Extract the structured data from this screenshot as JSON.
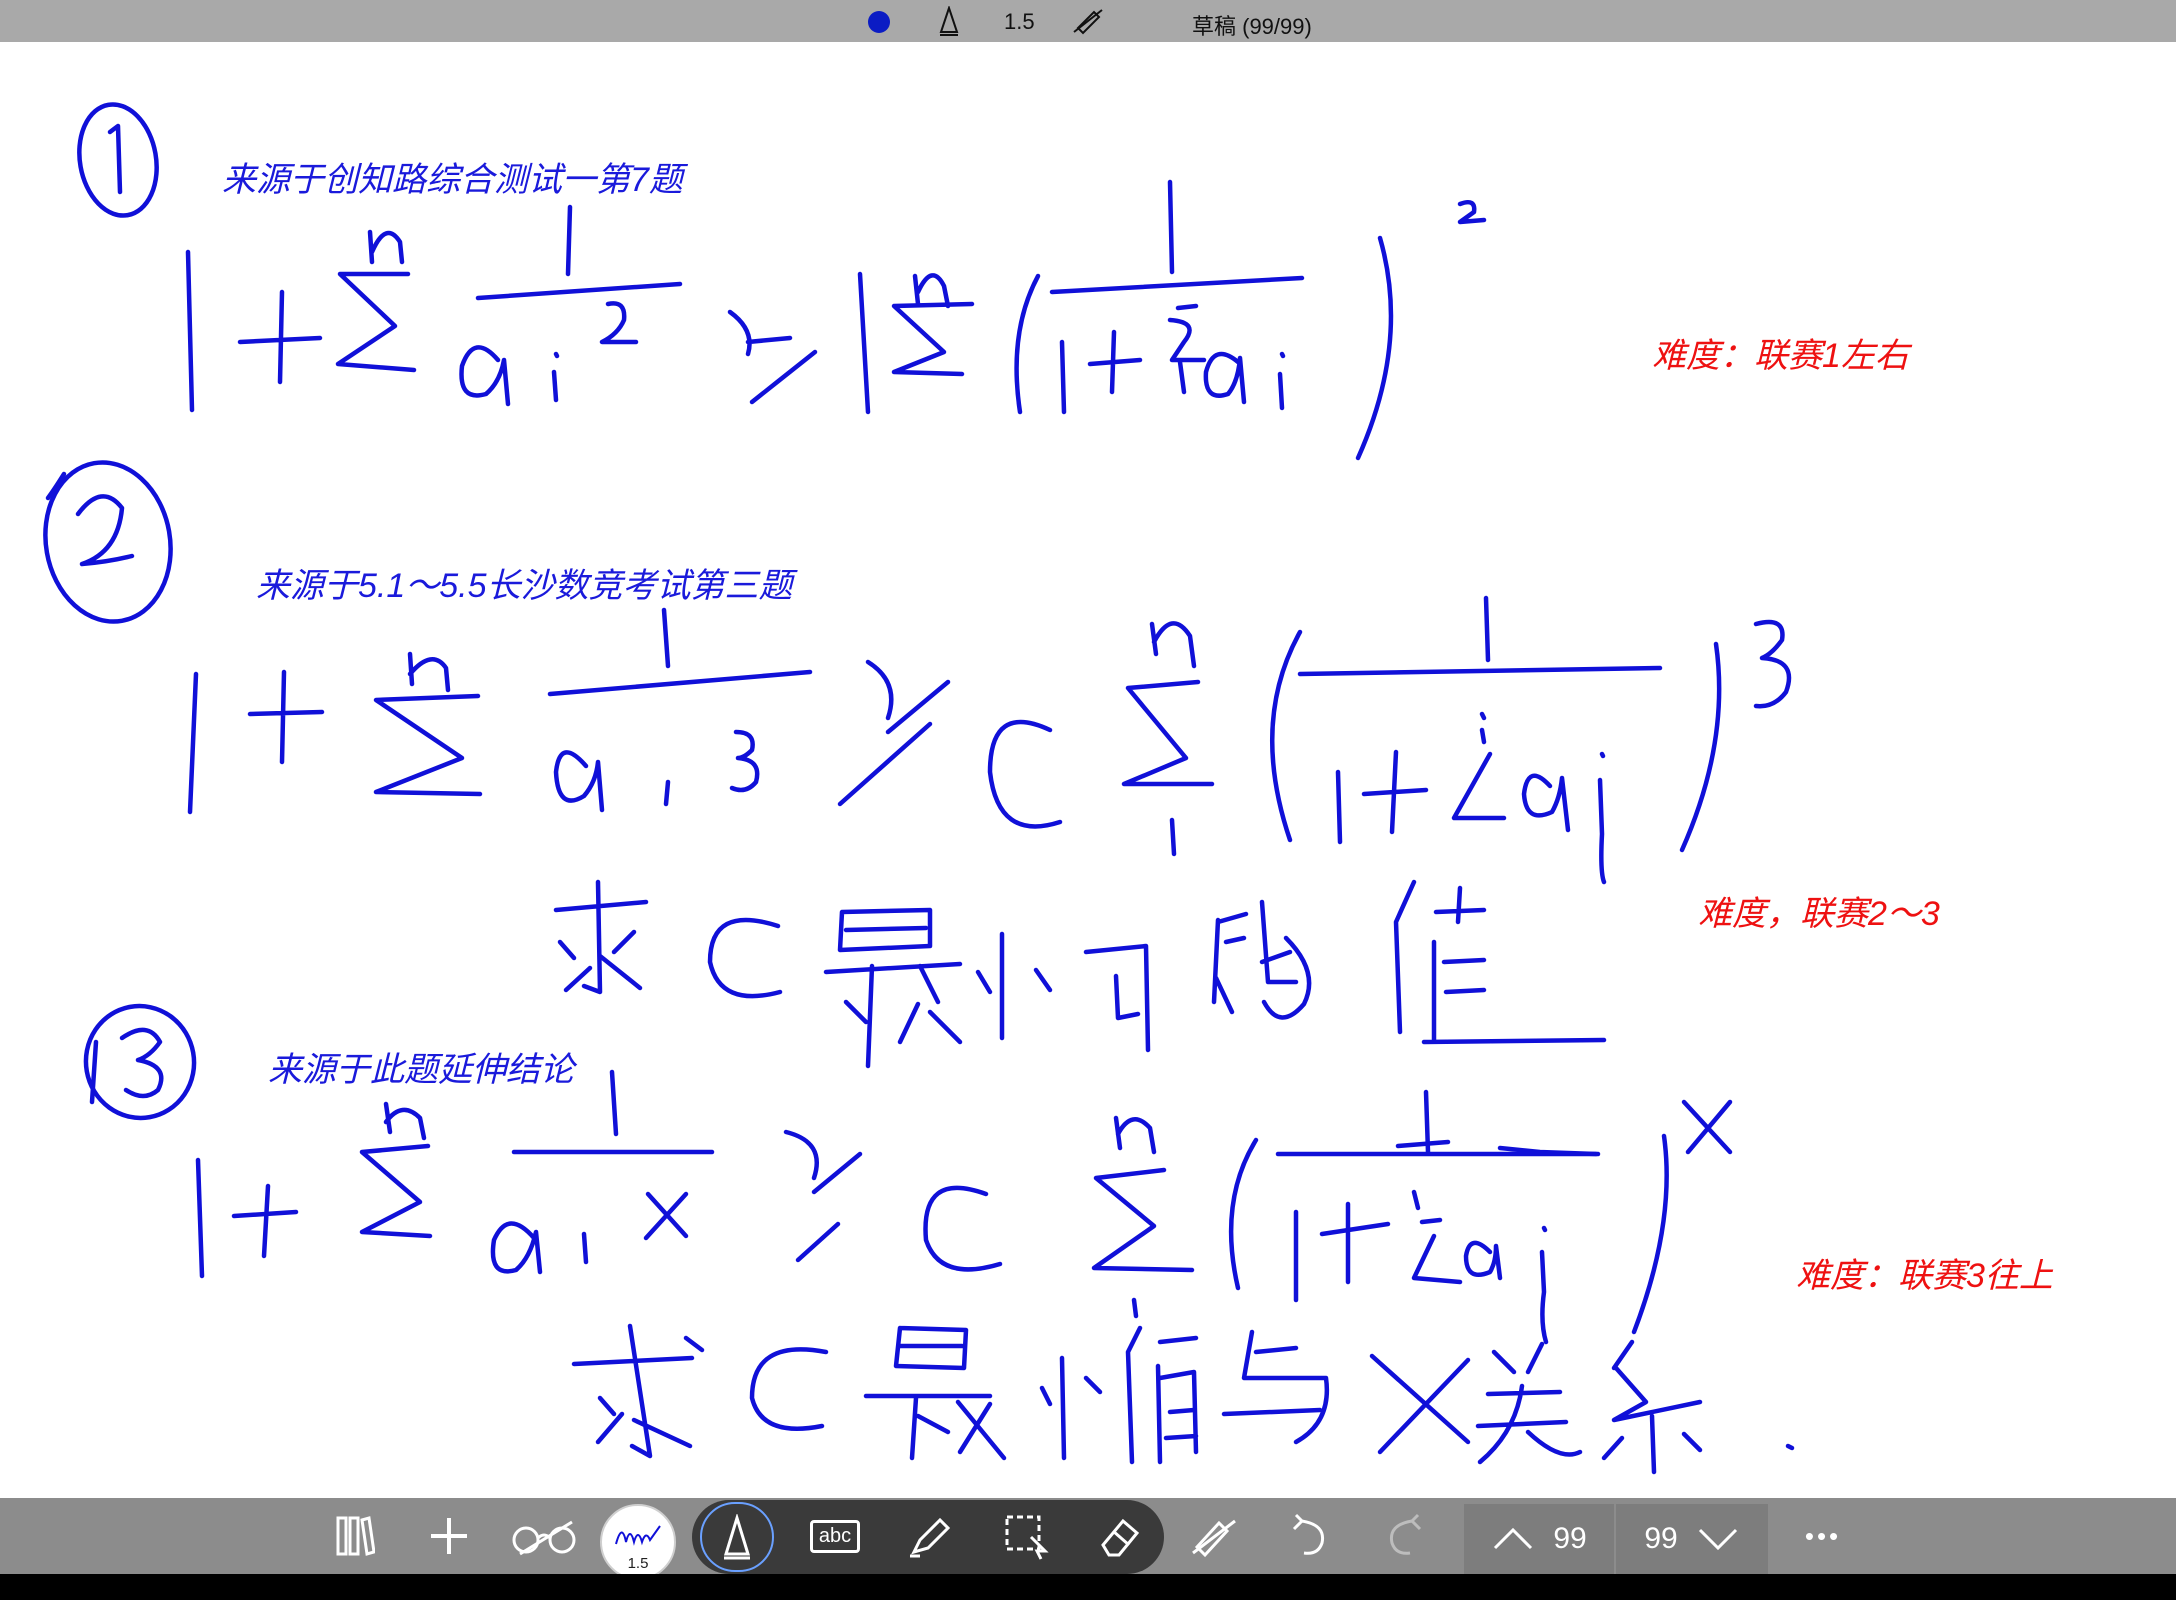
{
  "status_bar": {
    "pen_color": "#0b1cc4",
    "pen_size": "1.5",
    "title": "草稿 (99/99)"
  },
  "notes": {
    "source_1": "来源于创知路综合测试一第7题",
    "source_2": "来源于5.1～5.5长沙数竞考试第三题",
    "source_3": "来源于此题延伸结论",
    "difficulty_1": "难度：联赛1左右",
    "difficulty_2": "难度，联赛2～3",
    "difficulty_3": "难度：联赛3往上"
  },
  "toolbar": {
    "items": [
      "library-icon",
      "add-icon",
      "glasses-icon",
      "pen-icon",
      "highlighter-icon",
      "text-box-icon",
      "marker-icon",
      "lasso-select-icon",
      "eraser-icon",
      "pen-off-icon",
      "undo-icon",
      "redo-icon",
      "page-up-icon",
      "page-down-icon",
      "more-icon"
    ],
    "text_box_label": "abc",
    "pen_size": "1.5",
    "page_current": "99",
    "page_total": "99",
    "more_label": "•••"
  },
  "colors": {
    "ink": "#1010d8",
    "source_note": "#1a1adb",
    "difficulty_note": "#ee1111",
    "toolbar": "#8c8c8c",
    "topbar": "#a9a9a9"
  }
}
